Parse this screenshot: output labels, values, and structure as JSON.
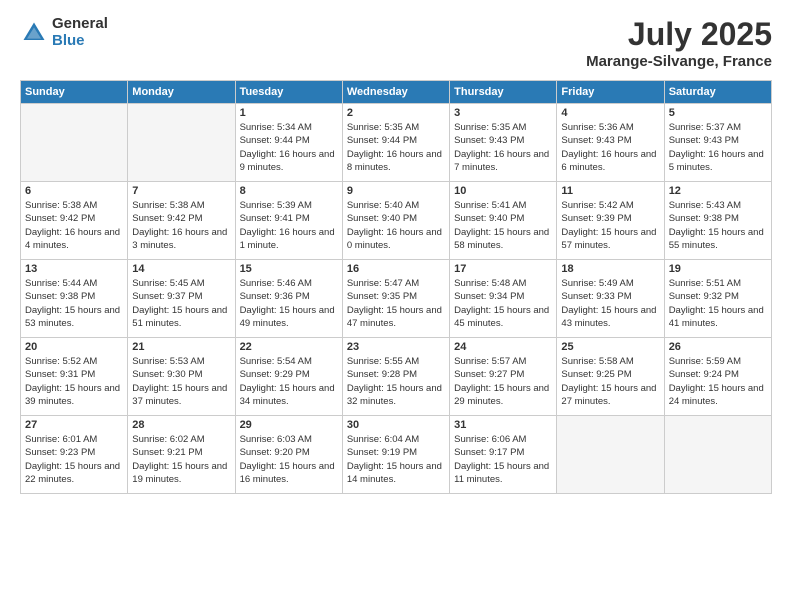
{
  "header": {
    "logo_general": "General",
    "logo_blue": "Blue",
    "month": "July 2025",
    "location": "Marange-Silvange, France"
  },
  "weekdays": [
    "Sunday",
    "Monday",
    "Tuesday",
    "Wednesday",
    "Thursday",
    "Friday",
    "Saturday"
  ],
  "weeks": [
    [
      {
        "day": "",
        "empty": true
      },
      {
        "day": "",
        "empty": true
      },
      {
        "day": "1",
        "sunrise": "Sunrise: 5:34 AM",
        "sunset": "Sunset: 9:44 PM",
        "daylight": "Daylight: 16 hours and 9 minutes."
      },
      {
        "day": "2",
        "sunrise": "Sunrise: 5:35 AM",
        "sunset": "Sunset: 9:44 PM",
        "daylight": "Daylight: 16 hours and 8 minutes."
      },
      {
        "day": "3",
        "sunrise": "Sunrise: 5:35 AM",
        "sunset": "Sunset: 9:43 PM",
        "daylight": "Daylight: 16 hours and 7 minutes."
      },
      {
        "day": "4",
        "sunrise": "Sunrise: 5:36 AM",
        "sunset": "Sunset: 9:43 PM",
        "daylight": "Daylight: 16 hours and 6 minutes."
      },
      {
        "day": "5",
        "sunrise": "Sunrise: 5:37 AM",
        "sunset": "Sunset: 9:43 PM",
        "daylight": "Daylight: 16 hours and 5 minutes."
      }
    ],
    [
      {
        "day": "6",
        "sunrise": "Sunrise: 5:38 AM",
        "sunset": "Sunset: 9:42 PM",
        "daylight": "Daylight: 16 hours and 4 minutes."
      },
      {
        "day": "7",
        "sunrise": "Sunrise: 5:38 AM",
        "sunset": "Sunset: 9:42 PM",
        "daylight": "Daylight: 16 hours and 3 minutes."
      },
      {
        "day": "8",
        "sunrise": "Sunrise: 5:39 AM",
        "sunset": "Sunset: 9:41 PM",
        "daylight": "Daylight: 16 hours and 1 minute."
      },
      {
        "day": "9",
        "sunrise": "Sunrise: 5:40 AM",
        "sunset": "Sunset: 9:40 PM",
        "daylight": "Daylight: 16 hours and 0 minutes."
      },
      {
        "day": "10",
        "sunrise": "Sunrise: 5:41 AM",
        "sunset": "Sunset: 9:40 PM",
        "daylight": "Daylight: 15 hours and 58 minutes."
      },
      {
        "day": "11",
        "sunrise": "Sunrise: 5:42 AM",
        "sunset": "Sunset: 9:39 PM",
        "daylight": "Daylight: 15 hours and 57 minutes."
      },
      {
        "day": "12",
        "sunrise": "Sunrise: 5:43 AM",
        "sunset": "Sunset: 9:38 PM",
        "daylight": "Daylight: 15 hours and 55 minutes."
      }
    ],
    [
      {
        "day": "13",
        "sunrise": "Sunrise: 5:44 AM",
        "sunset": "Sunset: 9:38 PM",
        "daylight": "Daylight: 15 hours and 53 minutes."
      },
      {
        "day": "14",
        "sunrise": "Sunrise: 5:45 AM",
        "sunset": "Sunset: 9:37 PM",
        "daylight": "Daylight: 15 hours and 51 minutes."
      },
      {
        "day": "15",
        "sunrise": "Sunrise: 5:46 AM",
        "sunset": "Sunset: 9:36 PM",
        "daylight": "Daylight: 15 hours and 49 minutes."
      },
      {
        "day": "16",
        "sunrise": "Sunrise: 5:47 AM",
        "sunset": "Sunset: 9:35 PM",
        "daylight": "Daylight: 15 hours and 47 minutes."
      },
      {
        "day": "17",
        "sunrise": "Sunrise: 5:48 AM",
        "sunset": "Sunset: 9:34 PM",
        "daylight": "Daylight: 15 hours and 45 minutes."
      },
      {
        "day": "18",
        "sunrise": "Sunrise: 5:49 AM",
        "sunset": "Sunset: 9:33 PM",
        "daylight": "Daylight: 15 hours and 43 minutes."
      },
      {
        "day": "19",
        "sunrise": "Sunrise: 5:51 AM",
        "sunset": "Sunset: 9:32 PM",
        "daylight": "Daylight: 15 hours and 41 minutes."
      }
    ],
    [
      {
        "day": "20",
        "sunrise": "Sunrise: 5:52 AM",
        "sunset": "Sunset: 9:31 PM",
        "daylight": "Daylight: 15 hours and 39 minutes."
      },
      {
        "day": "21",
        "sunrise": "Sunrise: 5:53 AM",
        "sunset": "Sunset: 9:30 PM",
        "daylight": "Daylight: 15 hours and 37 minutes."
      },
      {
        "day": "22",
        "sunrise": "Sunrise: 5:54 AM",
        "sunset": "Sunset: 9:29 PM",
        "daylight": "Daylight: 15 hours and 34 minutes."
      },
      {
        "day": "23",
        "sunrise": "Sunrise: 5:55 AM",
        "sunset": "Sunset: 9:28 PM",
        "daylight": "Daylight: 15 hours and 32 minutes."
      },
      {
        "day": "24",
        "sunrise": "Sunrise: 5:57 AM",
        "sunset": "Sunset: 9:27 PM",
        "daylight": "Daylight: 15 hours and 29 minutes."
      },
      {
        "day": "25",
        "sunrise": "Sunrise: 5:58 AM",
        "sunset": "Sunset: 9:25 PM",
        "daylight": "Daylight: 15 hours and 27 minutes."
      },
      {
        "day": "26",
        "sunrise": "Sunrise: 5:59 AM",
        "sunset": "Sunset: 9:24 PM",
        "daylight": "Daylight: 15 hours and 24 minutes."
      }
    ],
    [
      {
        "day": "27",
        "sunrise": "Sunrise: 6:01 AM",
        "sunset": "Sunset: 9:23 PM",
        "daylight": "Daylight: 15 hours and 22 minutes."
      },
      {
        "day": "28",
        "sunrise": "Sunrise: 6:02 AM",
        "sunset": "Sunset: 9:21 PM",
        "daylight": "Daylight: 15 hours and 19 minutes."
      },
      {
        "day": "29",
        "sunrise": "Sunrise: 6:03 AM",
        "sunset": "Sunset: 9:20 PM",
        "daylight": "Daylight: 15 hours and 16 minutes."
      },
      {
        "day": "30",
        "sunrise": "Sunrise: 6:04 AM",
        "sunset": "Sunset: 9:19 PM",
        "daylight": "Daylight: 15 hours and 14 minutes."
      },
      {
        "day": "31",
        "sunrise": "Sunrise: 6:06 AM",
        "sunset": "Sunset: 9:17 PM",
        "daylight": "Daylight: 15 hours and 11 minutes."
      },
      {
        "day": "",
        "empty": true
      },
      {
        "day": "",
        "empty": true
      }
    ]
  ]
}
